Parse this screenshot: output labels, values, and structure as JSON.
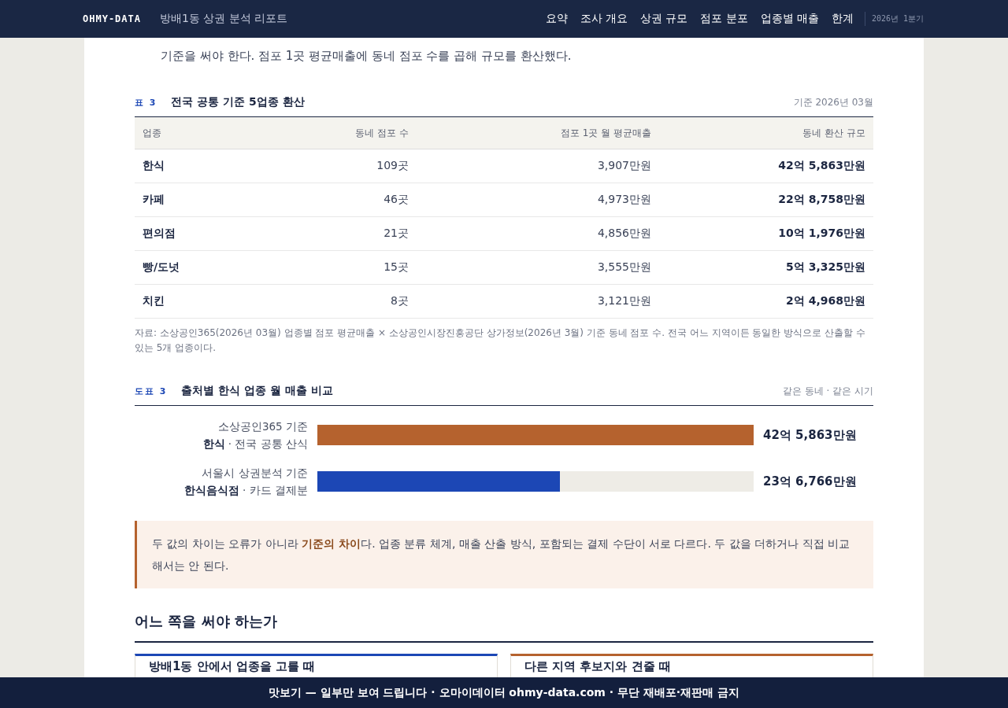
{
  "header": {
    "brand": "OHMY-DATA",
    "title": "방배1동 상권 분석 리포트",
    "nav": [
      "요약",
      "조사 개요",
      "상권 규모",
      "점포 분포",
      "업종별 매출",
      "한계"
    ],
    "period": "2026년 1분기"
  },
  "intro": "기준을 써야 한다. 점포 1곳 평균매출에 동네 점포 수를 곱해 규모를 환산했다.",
  "table": {
    "label": "표 3",
    "title": "전국 공통 기준 5업종 환산",
    "meta": "기준 2026년 03월",
    "columns": [
      "업종",
      "동네 점포 수",
      "점포 1곳 월 평균매출",
      "동네 환산 규모"
    ],
    "rows": [
      [
        "한식",
        "109곳",
        "3,907만원",
        "42억 5,863만원"
      ],
      [
        "카페",
        "46곳",
        "4,973만원",
        "22억 8,758만원"
      ],
      [
        "편의점",
        "21곳",
        "4,856만원",
        "10억 1,976만원"
      ],
      [
        "빵/도넛",
        "15곳",
        "3,555만원",
        "5억 3,325만원"
      ],
      [
        "치킨",
        "8곳",
        "3,121만원",
        "2억 4,968만원"
      ]
    ],
    "source": "자료: 소상공인365(2026년 03월) 업종별 점포 평균매출 × 소상공인시장진흥공단 상가정보(2026년 3월) 기준 동네 점포 수. 전국 어느 지역이든 동일한 방식으로 산출할 수 있는 5개 업종이다."
  },
  "figure": {
    "label": "도표 3",
    "title": "출처별 한식 업종 월 매출 비교",
    "meta": "같은 동네 · 같은 시기",
    "bars": [
      {
        "source": "소상공인365 기준",
        "category": "**한식** · 전국 공통 산식",
        "level": 1.0,
        "color": "#b5622e",
        "value": "42억 5,863만원"
      },
      {
        "source": "서울시 상권분석 기준",
        "category": "**한식음식점** · 카드 결제분",
        "level": 0.556,
        "color": "#1c47b5",
        "value": "23억 6,766만원"
      }
    ]
  },
  "note": "두 값의 차이는 오류가 아니라 **기준의 차이**다. 업종 분류 체계, 매출 산출 방식, 포함되는 결제 수단이 서로 다르다. 두 값을 더하거나 직접 비교해서는 안 된다.",
  "section": {
    "heading": "어느 쪽을 써야 하는가",
    "cards": [
      {
        "title": "방배1동 안에서 업종을 고를 때",
        "color": "#1c47b5"
      },
      {
        "title": "다른 지역 후보지와 견줄 때",
        "color": "#b5622e"
      }
    ]
  },
  "footer": "맛보기 — 일부만 보여 드립니다 · 오마이데이터 ohmy-data.com · 무단 재배포·재판매 금지"
}
